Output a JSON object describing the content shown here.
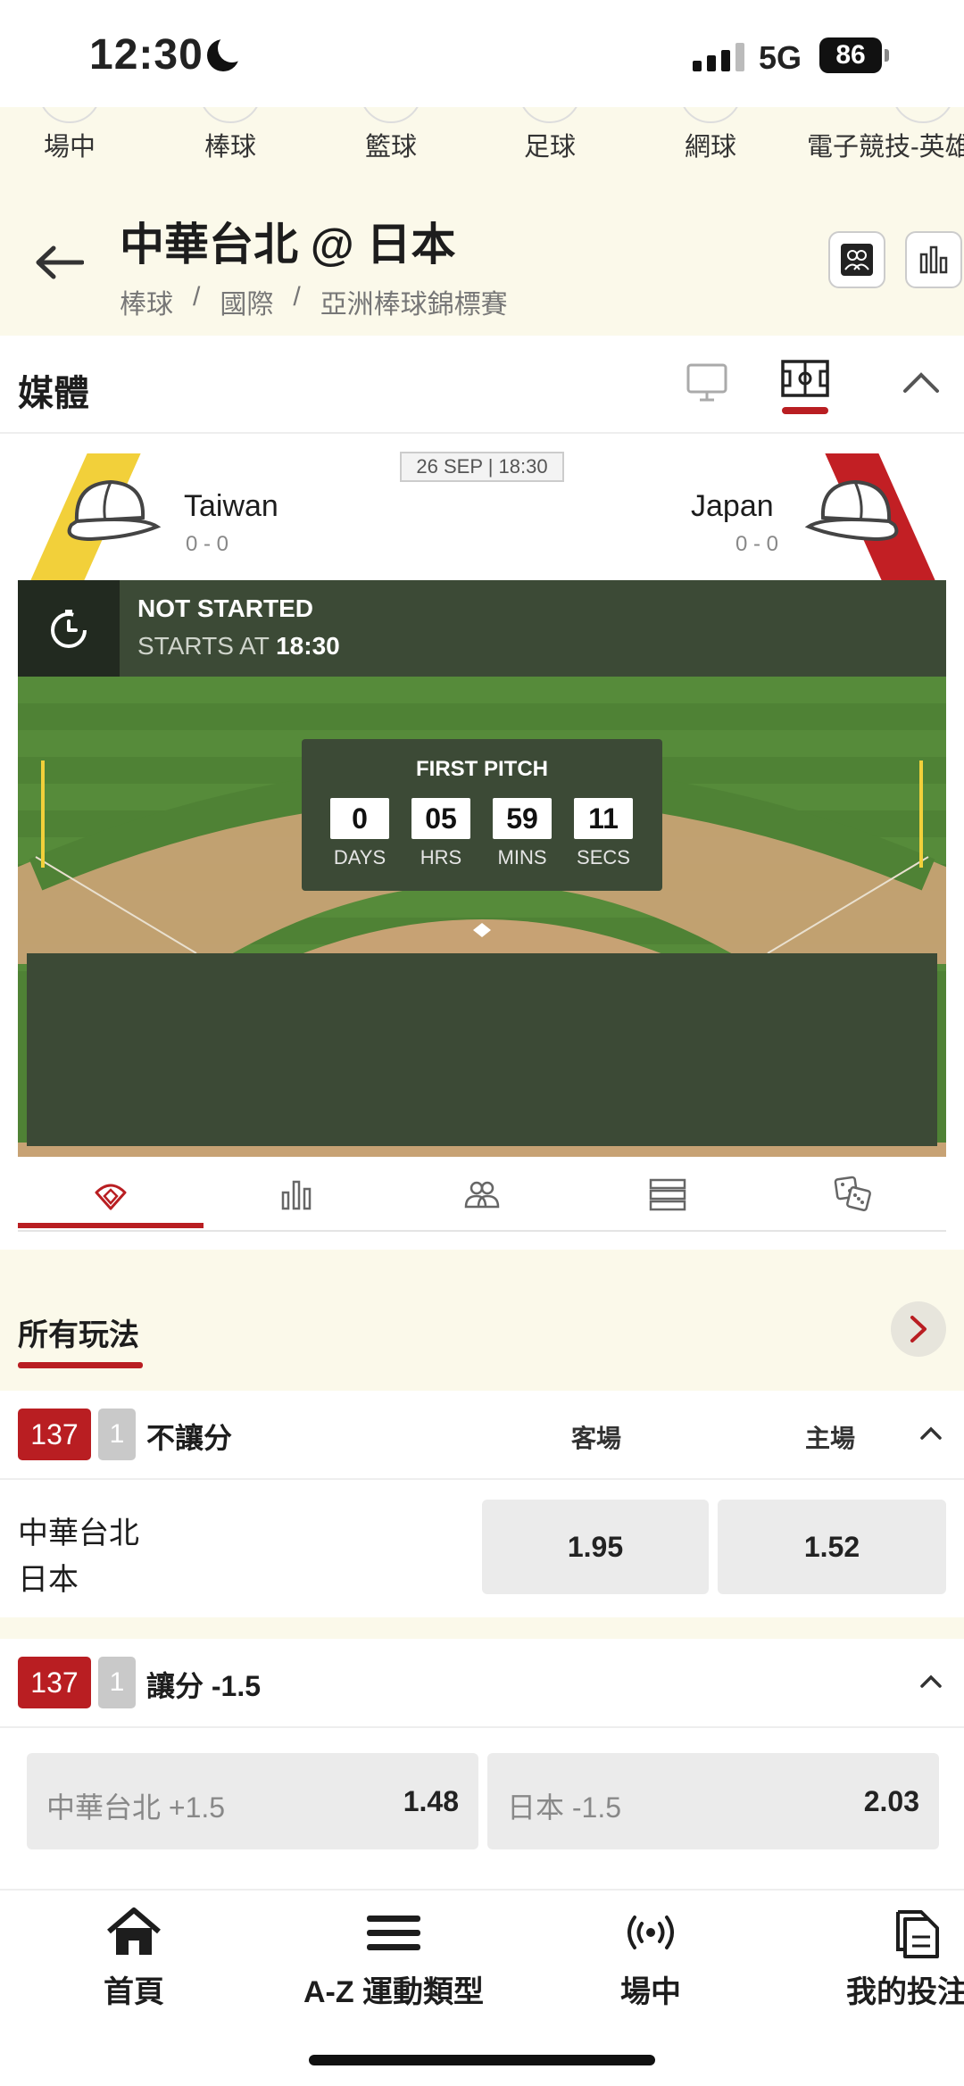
{
  "status_bar": {
    "time": "12:30",
    "network": "5G",
    "battery": "86"
  },
  "sport_tabs": [
    "場中",
    "棒球",
    "籃球",
    "足球",
    "網球",
    "電子競技-英雄"
  ],
  "match": {
    "title": "中華台北 @ 日本",
    "breadcrumb": [
      "棒球",
      "/",
      "國際",
      "/",
      "亞洲棒球錦標賽"
    ]
  },
  "media": {
    "title": "媒體"
  },
  "scoreboard": {
    "date": "26 SEP | 18:30",
    "home_team": {
      "name": "Taiwan",
      "score": "0 - 0",
      "color": "#f2d03a"
    },
    "away_team": {
      "name": "Japan",
      "score": "0 - 0",
      "color": "#c21f24"
    },
    "status": "NOT STARTED",
    "starts_at_label": "STARTS AT",
    "starts_at_time": "18:30",
    "countdown": {
      "title": "FIRST PITCH",
      "units": [
        {
          "value": "0",
          "label": "DAYS"
        },
        {
          "value": "05",
          "label": "HRS"
        },
        {
          "value": "59",
          "label": "MINS"
        },
        {
          "value": "11",
          "label": "SECS"
        }
      ]
    }
  },
  "stat_tabs": [
    "field-icon",
    "bar-chart-icon",
    "lineup-icon",
    "list-icon",
    "dice-icon"
  ],
  "all_bets": {
    "label": "所有玩法"
  },
  "markets": [
    {
      "id": "137",
      "count": "1",
      "title": "不讓分",
      "columns": [
        "客場",
        "主場"
      ],
      "teams": [
        "中華台北",
        "日本"
      ],
      "odds": [
        "1.95",
        "1.52"
      ]
    },
    {
      "id": "137",
      "count": "1",
      "title": "讓分 -1.5",
      "selections": [
        {
          "label": "中華台北 +1.5",
          "odd": "1.48"
        },
        {
          "label": "日本 -1.5",
          "odd": "2.03"
        }
      ]
    }
  ],
  "bottom_nav": [
    "首頁",
    "A-Z 運動類型",
    "場中",
    "我的投注"
  ],
  "colors": {
    "accent": "#b91e22",
    "cream": "#fbf9ea",
    "field_overlay": "#3c4a36"
  }
}
